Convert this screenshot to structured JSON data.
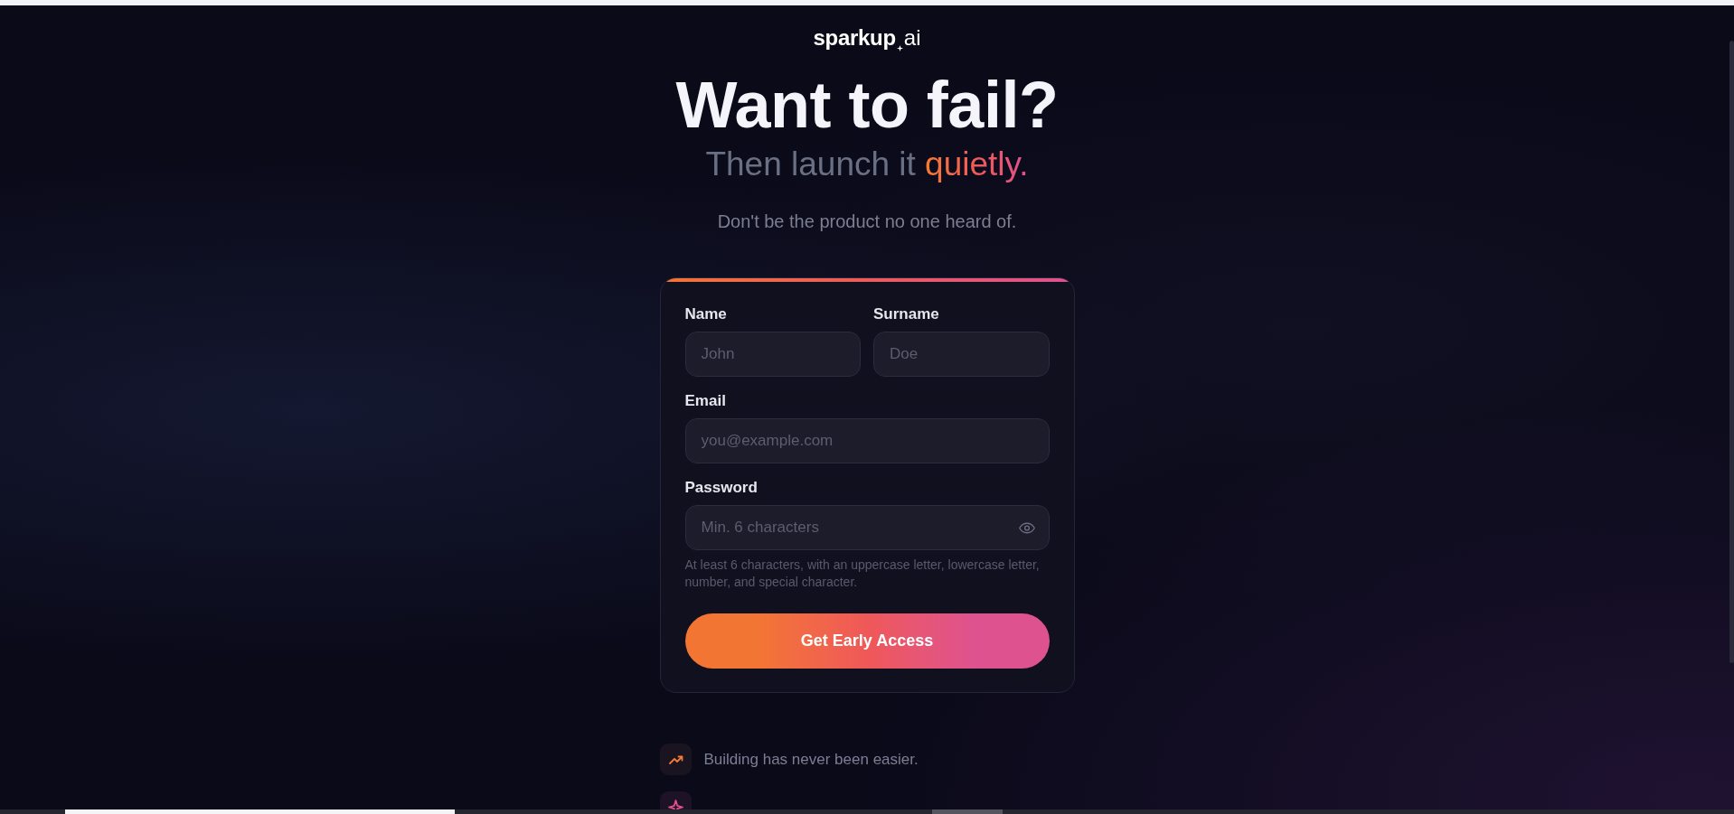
{
  "logo": {
    "name": "sparkup",
    "suffix": "ai"
  },
  "hero": {
    "title": "Want to fail?",
    "subtitle": "Then launch it",
    "subtitle_highlight": "quietly.",
    "tagline": "Don't be the product no one heard of."
  },
  "form": {
    "rows": [
      [
        {
          "kind": "text",
          "label": "Name",
          "placeholder": "John"
        },
        {
          "kind": "text",
          "label": "Surname",
          "placeholder": "Doe"
        }
      ],
      [
        {
          "kind": "email",
          "label": "Email",
          "placeholder": "you@example.com"
        }
      ],
      [
        {
          "kind": "password",
          "label": "Password",
          "placeholder": "Min. 6 characters",
          "hint": "At least 6 characters, with an uppercase letter, lowercase letter, number, and special character."
        }
      ]
    ],
    "submit": "Get Early Access"
  },
  "features": [
    {
      "kind": "trend",
      "text": "Building has never been easier."
    },
    {
      "kind": "spark"
    }
  ]
}
